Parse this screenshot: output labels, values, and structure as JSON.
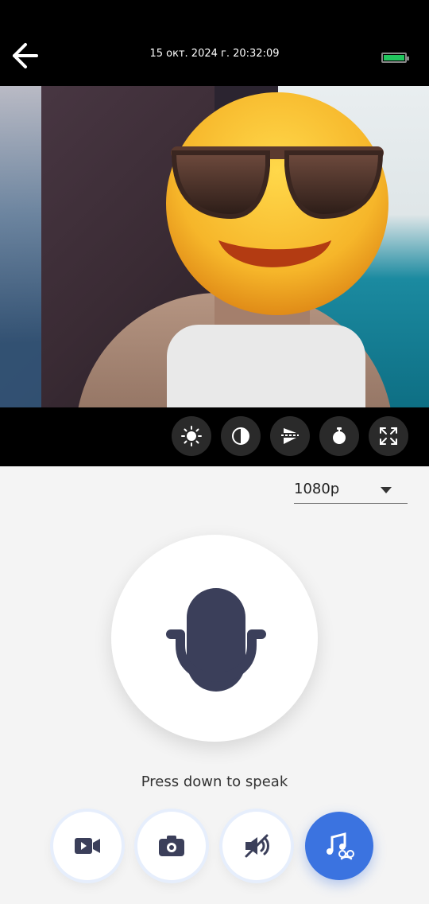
{
  "header": {
    "timestamp": "15 окт. 2024 г. 20:32:09",
    "battery_level": 0.92
  },
  "video_controls": {
    "icons": [
      "brightness-icon",
      "contrast-icon",
      "mirror-icon",
      "timer-icon",
      "fullscreen-icon"
    ]
  },
  "resolution": {
    "selected": "1080p"
  },
  "mic": {
    "prompt": "Press down to speak"
  },
  "actions": {
    "icons": [
      "record-video-icon",
      "snapshot-icon",
      "mute-icon",
      "voice-changer-icon"
    ],
    "active_color": "#3b73e0"
  }
}
